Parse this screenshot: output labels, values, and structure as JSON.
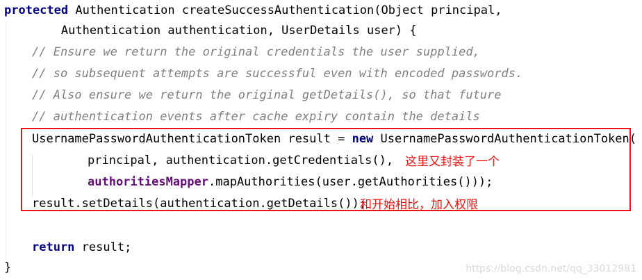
{
  "code": {
    "line1": {
      "keyword": "protected",
      "rest": " Authentication createSuccessAuthentication(Object principal,"
    },
    "line2": "        Authentication authentication, UserDetails user) {",
    "comments": [
      "// Ensure we return the original credentials the user supplied,",
      "// so subsequent attempts are successful even with encoded passwords.",
      "// Also ensure we return the original getDetails(), so that future",
      "// authentication events after cache expiry contain the details"
    ],
    "token_line": {
      "before": "UsernamePasswordAuthenticationToken result = ",
      "keyword": "new",
      "after": " UsernamePasswordAuthenticationToken("
    },
    "principal_line": "principal, authentication.getCredentials(),",
    "mapper_line": {
      "field": "authoritiesMapper",
      "rest": ".mapAuthorities(user.getAuthorities()));"
    },
    "details_line": "result.setDetails(authentication.getDetails());",
    "return_line": {
      "keyword": "return",
      "rest": " result;"
    },
    "close_brace": "}"
  },
  "annotations": {
    "note1": "这里又封装了一个",
    "note2": "和开始相比，加入权限"
  },
  "watermark": "https://blog.csdn.net/qq_33012981",
  "colors": {
    "keyword": "#000080",
    "comment": "#808080",
    "field": "#660e7a",
    "annotation": "#ee1111",
    "box": "#ee1111"
  }
}
